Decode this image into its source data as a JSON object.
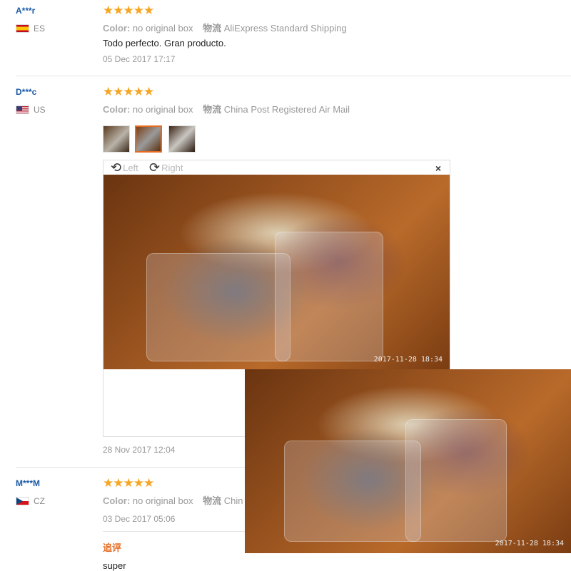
{
  "reviews": [
    {
      "user": "A***r",
      "country": "ES",
      "stars": "★★★★★",
      "color_label": "Color:",
      "color_value": "no original box",
      "shipping_label": "物流",
      "shipping_value": "AliExpress Standard Shipping",
      "text": "Todo perfecto. Gran producto.",
      "date": "05 Dec 2017 17:17"
    },
    {
      "user": "D***c",
      "country": "US",
      "stars": "★★★★★",
      "color_label": "Color:",
      "color_value": "no original box",
      "shipping_label": "物流",
      "shipping_value": "China Post Registered Air Mail",
      "date": "28 Nov 2017 12:04"
    },
    {
      "user": "M***M",
      "country": "CZ",
      "stars": "★★★★★",
      "color_label": "Color:",
      "color_value": "no original box",
      "shipping_label": "物流",
      "shipping_value": "Chin",
      "date": "03 Dec 2017 05:06",
      "followup_label": "追评",
      "followup_text": "super"
    }
  ],
  "viewer": {
    "rotate_left": "Left",
    "rotate_right": "Right",
    "close": "×",
    "timestamp": "2017-11-28 18:34"
  },
  "zoom": {
    "timestamp": "2017-11-28 18:34"
  },
  "icons": {
    "rotate_left": "rotate-left-icon",
    "rotate_right": "rotate-right-icon",
    "close": "close-icon",
    "star": "star-icon"
  },
  "colors": {
    "accent": "#e66a1f",
    "star": "#f5a623",
    "user": "#1a5aa6"
  }
}
